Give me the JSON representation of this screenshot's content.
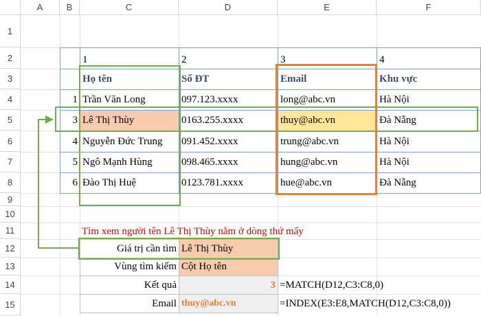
{
  "columns": [
    "A",
    "B",
    "C",
    "D",
    "E",
    "F"
  ],
  "rows": [
    "1",
    "2",
    "3",
    "4",
    "5",
    "6",
    "7",
    "8",
    "9",
    "10",
    "11",
    "12",
    "13",
    "14",
    "15"
  ],
  "header_row": [
    "1",
    "2",
    "3",
    "4"
  ],
  "table_headers": [
    "Họ tên",
    "Số ĐT",
    "Email",
    "Khu vực"
  ],
  "records": [
    {
      "no": "1",
      "name": "Trần Văn Long",
      "phone": "097.123.xxxx",
      "email": "long@abc.vn",
      "region": "Hà Nội"
    },
    {
      "no": "3",
      "name": "Lê Thị Thùy",
      "phone": "0163.255.xxxx",
      "email": "thuy@abc.vn",
      "region": "Đà Nẵng"
    },
    {
      "no": "4",
      "name": "Nguyễn Đức Trung",
      "phone": "091.452.xxxx",
      "email": "trung@abc.vn",
      "region": "Hà Nội"
    },
    {
      "no": "5",
      "name": "Ngô Mạnh Hùng",
      "phone": "098.465.xxxx",
      "email": "hung@abc.vn",
      "region": "Hà Nội"
    },
    {
      "no": "6",
      "name": "Đào Thị Huệ",
      "phone": "0123.781.xxxx",
      "email": "hue@abc.vn",
      "region": "Đà Nẵng"
    }
  ],
  "question": "Tìm xem người tên Lê Thị Thùy nằm ở dòng thứ mấy",
  "lookup": {
    "value_label": "Giá trị cần tìm",
    "value": "Lê Thị Thùy",
    "range_label": "Vùng tìm kiếm",
    "range": "Cột Họ tên",
    "result_label": "Kết quả",
    "result": "3",
    "result_formula": "=MATCH(D12,C3:C8,0)",
    "email_label": "Email",
    "email": "thuy@abc.vn",
    "email_formula": "=INDEX(E3:E8,MATCH(D12,C3:C8,0))"
  },
  "colors": {
    "highlight_salmon": "#f8cbad",
    "highlight_yellow": "#ffe699",
    "result_gray": "#efefef",
    "green_outline": "#70ad47",
    "orange_outline": "#ed7d31",
    "question_red": "#e00000",
    "result_orange": "#ed7d31"
  }
}
